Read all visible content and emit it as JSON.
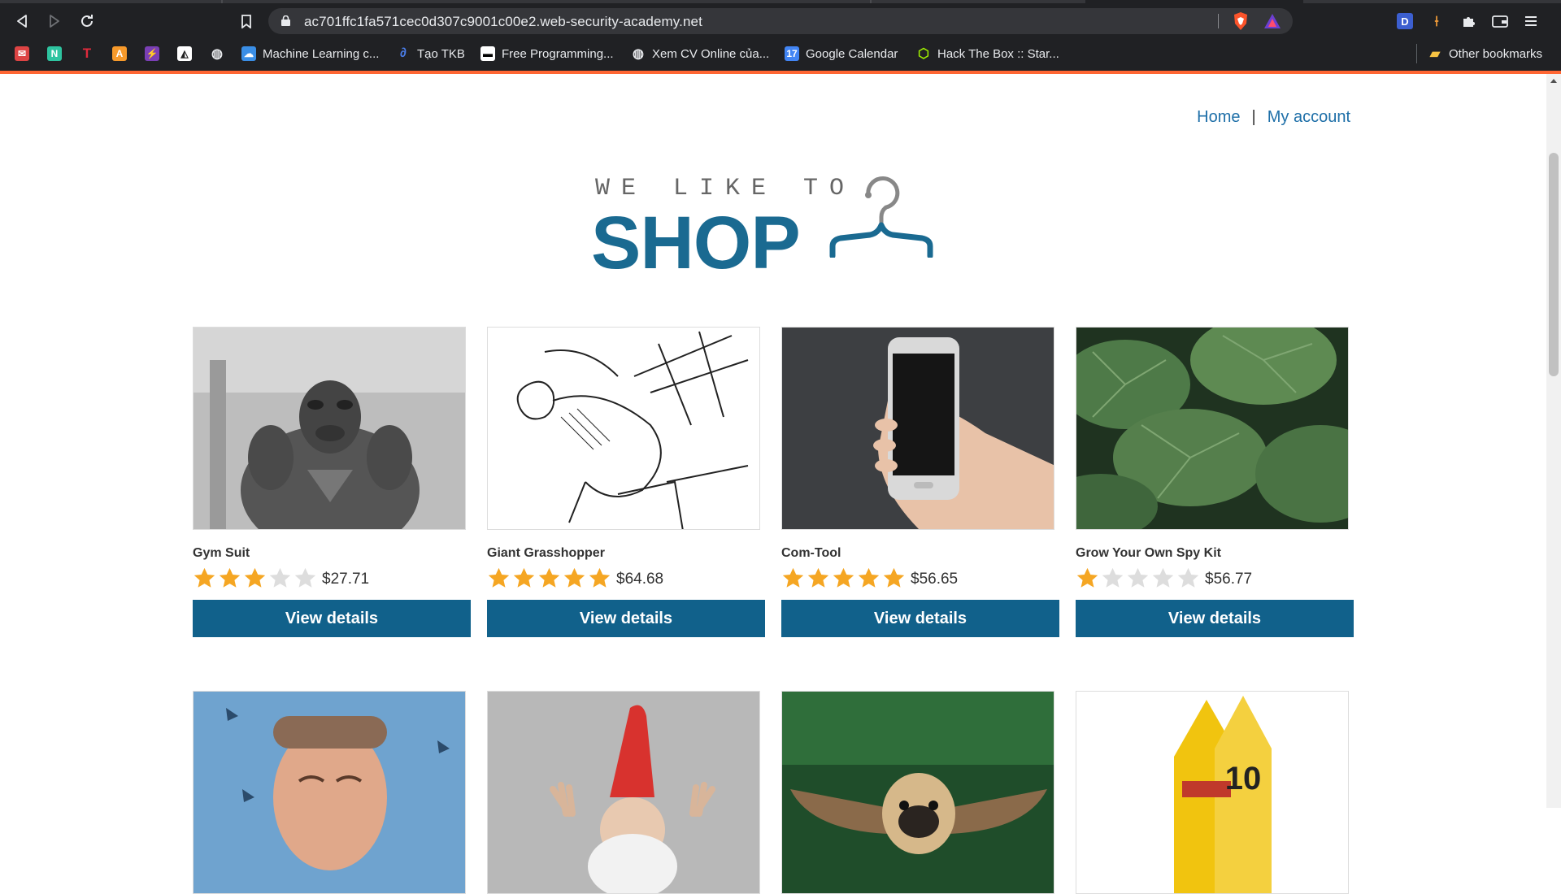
{
  "browser": {
    "url": "ac701ffc1fa571cec0d307c9001c00e2.web-security-academy.net",
    "bookmarks": [
      {
        "label": "",
        "icon": "mail-icon"
      },
      {
        "label": "",
        "icon": "n-icon"
      },
      {
        "label": "",
        "icon": "t-icon"
      },
      {
        "label": "",
        "icon": "a-icon"
      },
      {
        "label": "",
        "icon": "bolt-icon"
      },
      {
        "label": "",
        "icon": "wolf-icon"
      },
      {
        "label": "",
        "icon": "globe-icon"
      },
      {
        "label": "Machine Learning c...",
        "icon": "cloud-icon"
      },
      {
        "label": "Tạo TKB",
        "icon": "swirl-icon"
      },
      {
        "label": "Free Programming...",
        "icon": "book-icon"
      },
      {
        "label": "Xem CV Online của...",
        "icon": "globe-icon"
      },
      {
        "label": "Google Calendar",
        "icon": "calendar-icon"
      },
      {
        "label": "Hack The Box :: Star...",
        "icon": "cube-icon"
      }
    ],
    "other_bookmarks": "Other bookmarks"
  },
  "nav": {
    "home": "Home",
    "separator": "|",
    "account": "My account"
  },
  "logo": {
    "tagline": "WE LIKE TO",
    "word": "SHOP"
  },
  "colors": {
    "accent": "#ff6633",
    "brand": "#1a6a91",
    "button": "#11618b",
    "link": "#1e6fa8",
    "star_on": "#f5a623",
    "star_off": "#dddddd"
  },
  "products": [
    {
      "name": "Gym Suit",
      "rating": 3,
      "price": "$27.71",
      "image": "gym-dog",
      "button": "View details"
    },
    {
      "name": "Giant Grasshopper",
      "rating": 5,
      "price": "$64.68",
      "image": "grasshopper-sketch",
      "button": "View details"
    },
    {
      "name": "Com-Tool",
      "rating": 5,
      "price": "$56.65",
      "image": "phone-hand",
      "button": "View details"
    },
    {
      "name": "Grow Your Own Spy Kit",
      "rating": 1,
      "price": "$56.77",
      "image": "leaves",
      "button": "View details"
    },
    {
      "name": "",
      "rating": 0,
      "price": "",
      "image": "man-sneeze",
      "button": ""
    },
    {
      "name": "",
      "rating": 0,
      "price": "",
      "image": "gnome",
      "button": ""
    },
    {
      "name": "",
      "rating": 0,
      "price": "",
      "image": "flying-pug",
      "button": ""
    },
    {
      "name": "",
      "rating": 0,
      "price": "",
      "image": "caution-signs",
      "button": ""
    }
  ]
}
